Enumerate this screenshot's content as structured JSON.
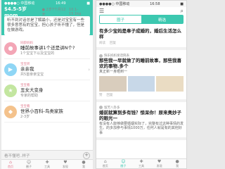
{
  "left": {
    "status": {
      "carrier": "●●●●○ 中国移动",
      "time": "16:49",
      "battery": "■"
    },
    "header": {
      "title": "$4.5-5岁 mom",
      "center": "● 2岁7个月12天",
      "right": "10.1-15.1kg"
    },
    "notice": "听不到对话总是了解最小，还是对宝宝有一些很多意思有的宝宝，担心孩子听不懂了，但是在做游戏。",
    "items": [
      {
        "tag": "同龄妈妈",
        "title": "睡前故事讲1个还是讲N个?",
        "sub": "1个宝宝下以及宝宝的",
        "icon": "●"
      },
      {
        "tag": "宝宝听",
        "title": "亲亲我",
        "sub": "共5首亲亲宝宝",
        "icon": "▶"
      },
      {
        "tag": "宝宝看",
        "title": "丑女大变身",
        "sub": "专家的帮助",
        "icon": "★"
      },
      {
        "tag": "宝宝看",
        "title": "世界小百科-鸟类家族",
        "sub": "2-3岁",
        "icon": "◆"
      }
    ],
    "input": {
      "placeholder": "看不懂吧..样子",
      "add": "+"
    },
    "tabs": [
      {
        "icon": "⌂",
        "label": "首页"
      },
      {
        "icon": "☺",
        "label": "圈子"
      },
      {
        "icon": "✚",
        "label": "工具"
      },
      {
        "icon": "♥",
        "label": "发现"
      },
      {
        "icon": "●",
        "label": "我"
      }
    ]
  },
  "right": {
    "status": {
      "carrier": "●●●●○ 中国移动",
      "time": "16:58",
      "battery": "■"
    },
    "topbar": {
      "menu": "☰",
      "search": "⌕"
    },
    "segments": [
      "圈子",
      "精选"
    ],
    "posts": [
      {
        "title": "有多少宝妈是奉子成婚的，婚后生活怎么样",
        "author": "",
        "body": "",
        "footer": [
          "阅读",
          "回复"
        ],
        "thumbs": false
      },
      {
        "title": "那些我一早就做了的睡前故事，那些我喜欢的事物.多个",
        "author": "快乐妈妈发话筒表",
        "body": "真正新一身晒到一",
        "footer": [
          "赞",
          "回复"
        ],
        "thumbs": true
      },
      {
        "title": "婚前就算到多有钱？惊呆你！原来奥妙子的眼光一",
        "author": "留芳八卦多",
        "body": "有没有人能够做要婚姻实际了，完整有过这种事情的发生。的多加参与事情1000万，任何人就是有的其他好事",
        "footer": [
          "赞",
          "回复"
        ],
        "thumbs": false
      }
    ],
    "tabs": [
      {
        "icon": "⌂",
        "label": "首页"
      },
      {
        "icon": "☺",
        "label": "圈子"
      },
      {
        "icon": "✚",
        "label": "工具"
      },
      {
        "icon": "♥",
        "label": "发现"
      },
      {
        "icon": "●",
        "label": "我"
      }
    ]
  }
}
